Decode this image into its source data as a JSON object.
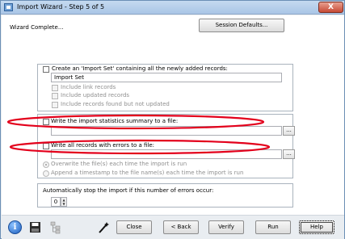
{
  "window": {
    "title": "Import Wizard - Step 5 of 5",
    "close_label": "X"
  },
  "header": {
    "status_text": "Wizard Complete...",
    "session_defaults_label": "Session Defaults..."
  },
  "import_set": {
    "create_label": "Create an 'Import Set' containing all the newly added records:",
    "name_value": "Import Set",
    "options": [
      "Include link records",
      "Include updated records",
      "Include records found but not updated"
    ]
  },
  "files": {
    "summary_label": "Write the import statistics summary to a file:",
    "summary_value": "",
    "errors_label": "Write all records with errors to a file:",
    "errors_value": "",
    "browse_label": "...",
    "overwrite_label": "Overwrite the file(s) each time the import is run",
    "append_label": "Append a timestamp to the file name(s) each time the import is run"
  },
  "errors": {
    "stop_label": "Automatically stop the import if this number of errors occur:",
    "value": "0"
  },
  "footer": {
    "info_glyph": "i",
    "buttons": [
      "Close",
      "< Back",
      "Verify",
      "Run",
      "Help"
    ]
  },
  "annotation": {
    "color": "#e3001b"
  },
  "colors": {
    "title_bar": "#b8d1ec",
    "window_frame": "#e9edf1",
    "close_button": "#c74a35"
  }
}
